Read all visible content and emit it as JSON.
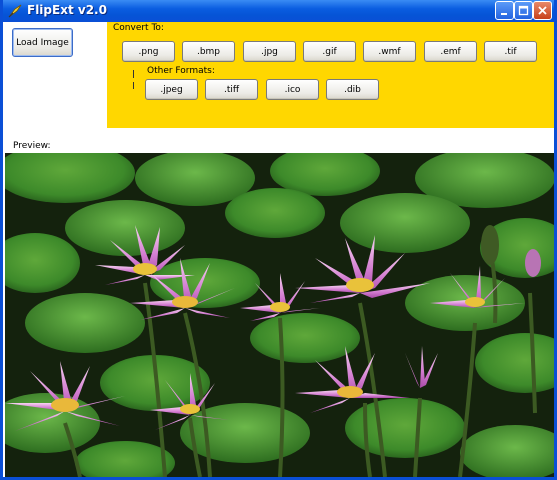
{
  "window": {
    "title": "FlipExt v2.0",
    "icon": "app-feather-icon",
    "controls": {
      "minimize_icon": "minimize-icon",
      "maximize_icon": "maximize-icon",
      "close_icon": "close-icon"
    }
  },
  "toolbar": {
    "load_label": "Load Image"
  },
  "convert_panel": {
    "title": "Convert To:",
    "formats": [
      ".png",
      ".bmp",
      ".jpg",
      ".gif",
      ".wmf",
      ".emf",
      ".tif"
    ],
    "other_title": "Other Formats:",
    "other_formats": [
      ".jpeg",
      ".tiff",
      ".ico",
      ".dib"
    ],
    "background_color": "#ffd700"
  },
  "preview": {
    "label": "Preview:",
    "image": "water-lilies-photo"
  }
}
